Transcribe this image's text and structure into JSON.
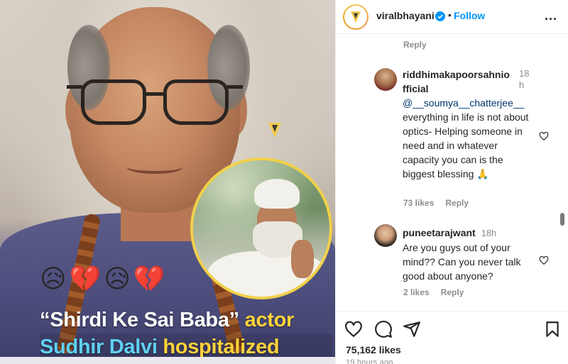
{
  "post": {
    "emojis": [
      "😥",
      "💔",
      "😥",
      "💔"
    ],
    "headline_line1_quote": "“Shirdi Ke Sai Baba”",
    "headline_line1_rest": " actor",
    "headline_line2_name": "Sudhir Dalvi",
    "headline_line2_rest": " hospitalized"
  },
  "header": {
    "username": "viralbhayani",
    "separator": "•",
    "follow_label": "Follow",
    "more_label": "..."
  },
  "comments": {
    "top_reply_label": "Reply",
    "items": [
      {
        "username": "riddhimakapoorsahnio\nfficial",
        "time": "18\nh",
        "mention": "@__soumya__chatterjee__",
        "text": "everything in life is not about optics- Helping someone in need and in whatever capacity you can is the biggest blessing 🙏",
        "likes": "73 likes",
        "reply_label": "Reply"
      },
      {
        "username": "puneetarajwant",
        "time": "18h",
        "text": "Are you guys out of your mind?? Can you never talk good about anyone?",
        "likes": "2 likes",
        "reply_label": "Reply"
      }
    ]
  },
  "actions": {
    "icons": [
      "heart-icon",
      "comment-icon",
      "share-icon",
      "bookmark-icon"
    ],
    "likes_count": "75,162 likes",
    "time_ago": "19 hours ago"
  },
  "colors": {
    "accent_blue": "#0095f6",
    "headline_cyan": "#5fd1f3",
    "headline_yellow": "#ffd23a",
    "brand_yellow": "#f2c94c"
  }
}
